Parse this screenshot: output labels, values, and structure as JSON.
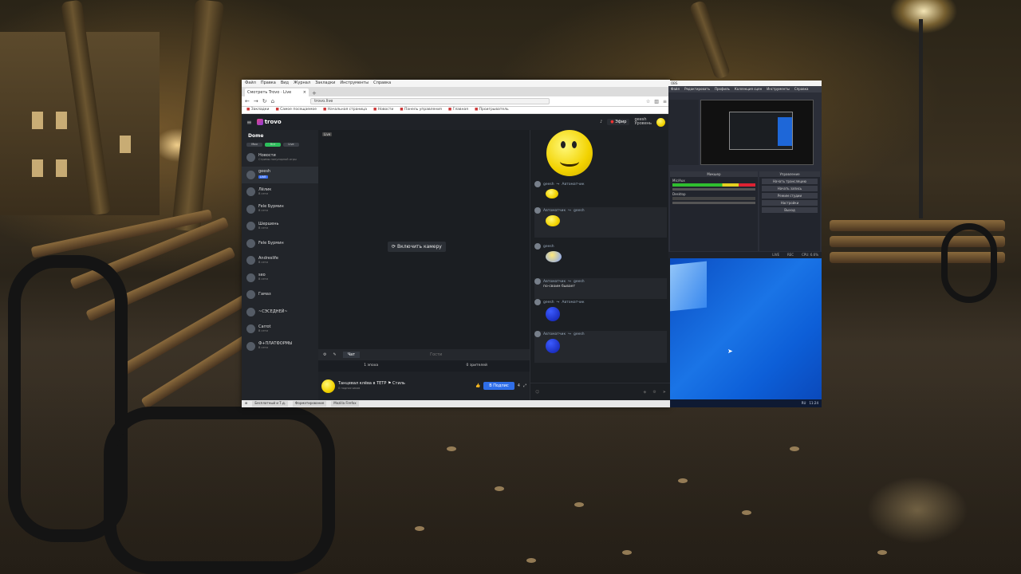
{
  "browser": {
    "menu": [
      "Файл",
      "Правка",
      "Вид",
      "Журнал",
      "Закладки",
      "Инструменты",
      "Справка"
    ],
    "tab_label": "Смотреть Trovo · Live",
    "url": "trovo.live",
    "bookmarks": [
      "Закладки",
      "Самое посещаемое",
      "Начальная страница",
      "Новости",
      "Панель управления",
      "Главная",
      "Проигрыватель"
    ]
  },
  "app": {
    "logo_text": "trovo",
    "live_button": "Эфир",
    "user_name": "geesh",
    "user_sub": "Уровень"
  },
  "sidebar": {
    "title": "Dome",
    "chips": [
      "Мои",
      "Все",
      "Live"
    ],
    "items": [
      {
        "name": "Новости",
        "sub": "Стримы популярной игры"
      },
      {
        "name": "geesh",
        "sub": "",
        "badge": "LIVE"
      },
      {
        "name": "Лёлик",
        "sub": "В сети"
      },
      {
        "name": "Fele Бурмин",
        "sub": "В сети"
      },
      {
        "name": "Шершень",
        "sub": "В сети"
      },
      {
        "name": "Fele Бурмин",
        "sub": ""
      },
      {
        "name": "Andreslife",
        "sub": "В сети"
      },
      {
        "name": "seo",
        "sub": "В сети"
      },
      {
        "name": "Гамаз",
        "sub": ""
      },
      {
        "name": "~СЭСЕДНЕЙ~",
        "sub": ""
      },
      {
        "name": "Carrot",
        "sub": "В сети"
      },
      {
        "name": "Ф+ПЛАТФОРМЫ",
        "sub": "В сети"
      }
    ]
  },
  "player": {
    "tag": "Live",
    "enable_camera": "Включить камеру",
    "tab_chat": "Чат",
    "tab_other": "Гости",
    "stat_left": "1 эпоха",
    "stat_right": "0 зрителей"
  },
  "streamer": {
    "title": "Танцевал клёва в ТЕТР ⚑ Стиль",
    "sub": "0 подписчиков",
    "follow_label": "В Подпис",
    "like_count": "4"
  },
  "chat": {
    "messages": [
      {
        "user": "geesh",
        "to": "Автоматчик",
        "text": ""
      },
      {
        "user": "Автоматчик",
        "to": "geesh",
        "text": ""
      },
      {
        "user": "geesh",
        "to": "",
        "text": ""
      },
      {
        "user": "Автоматчик",
        "to": "geesh",
        "text": "по-своим бывает"
      },
      {
        "user": "geesh",
        "to": "Автоматчик",
        "text": ""
      },
      {
        "user": "Автоматчик",
        "to": "geesh",
        "text": ""
      }
    ]
  },
  "taskbar": {
    "items": [
      "Бесплатный и Т.д.",
      "Форматирование",
      "Mozilla Firefox"
    ]
  },
  "obs": {
    "title": "OBS",
    "menu": [
      "Файл",
      "Редактировать",
      "Профиль",
      "Коллекция сцен",
      "Инструменты",
      "Справка"
    ],
    "mixer_title": "Микшер",
    "mixer_channels": [
      "Mic/Aux",
      "Desktop"
    ],
    "controls_title": "Управление",
    "controls": [
      "Начать трансляцию",
      "Начать запись",
      "Режим студии",
      "Настройки",
      "Выход"
    ],
    "status": [
      "LIVE",
      "REC",
      "CPU: 6.6%"
    ]
  },
  "desktop": {
    "tray": [
      "RU",
      "11:24"
    ]
  },
  "colors": {
    "trovo_bg": "#1a1d22",
    "follow_blue": "#2f6ee8",
    "live_green": "#2dbf5c",
    "obs_bg": "#2b2e38"
  }
}
